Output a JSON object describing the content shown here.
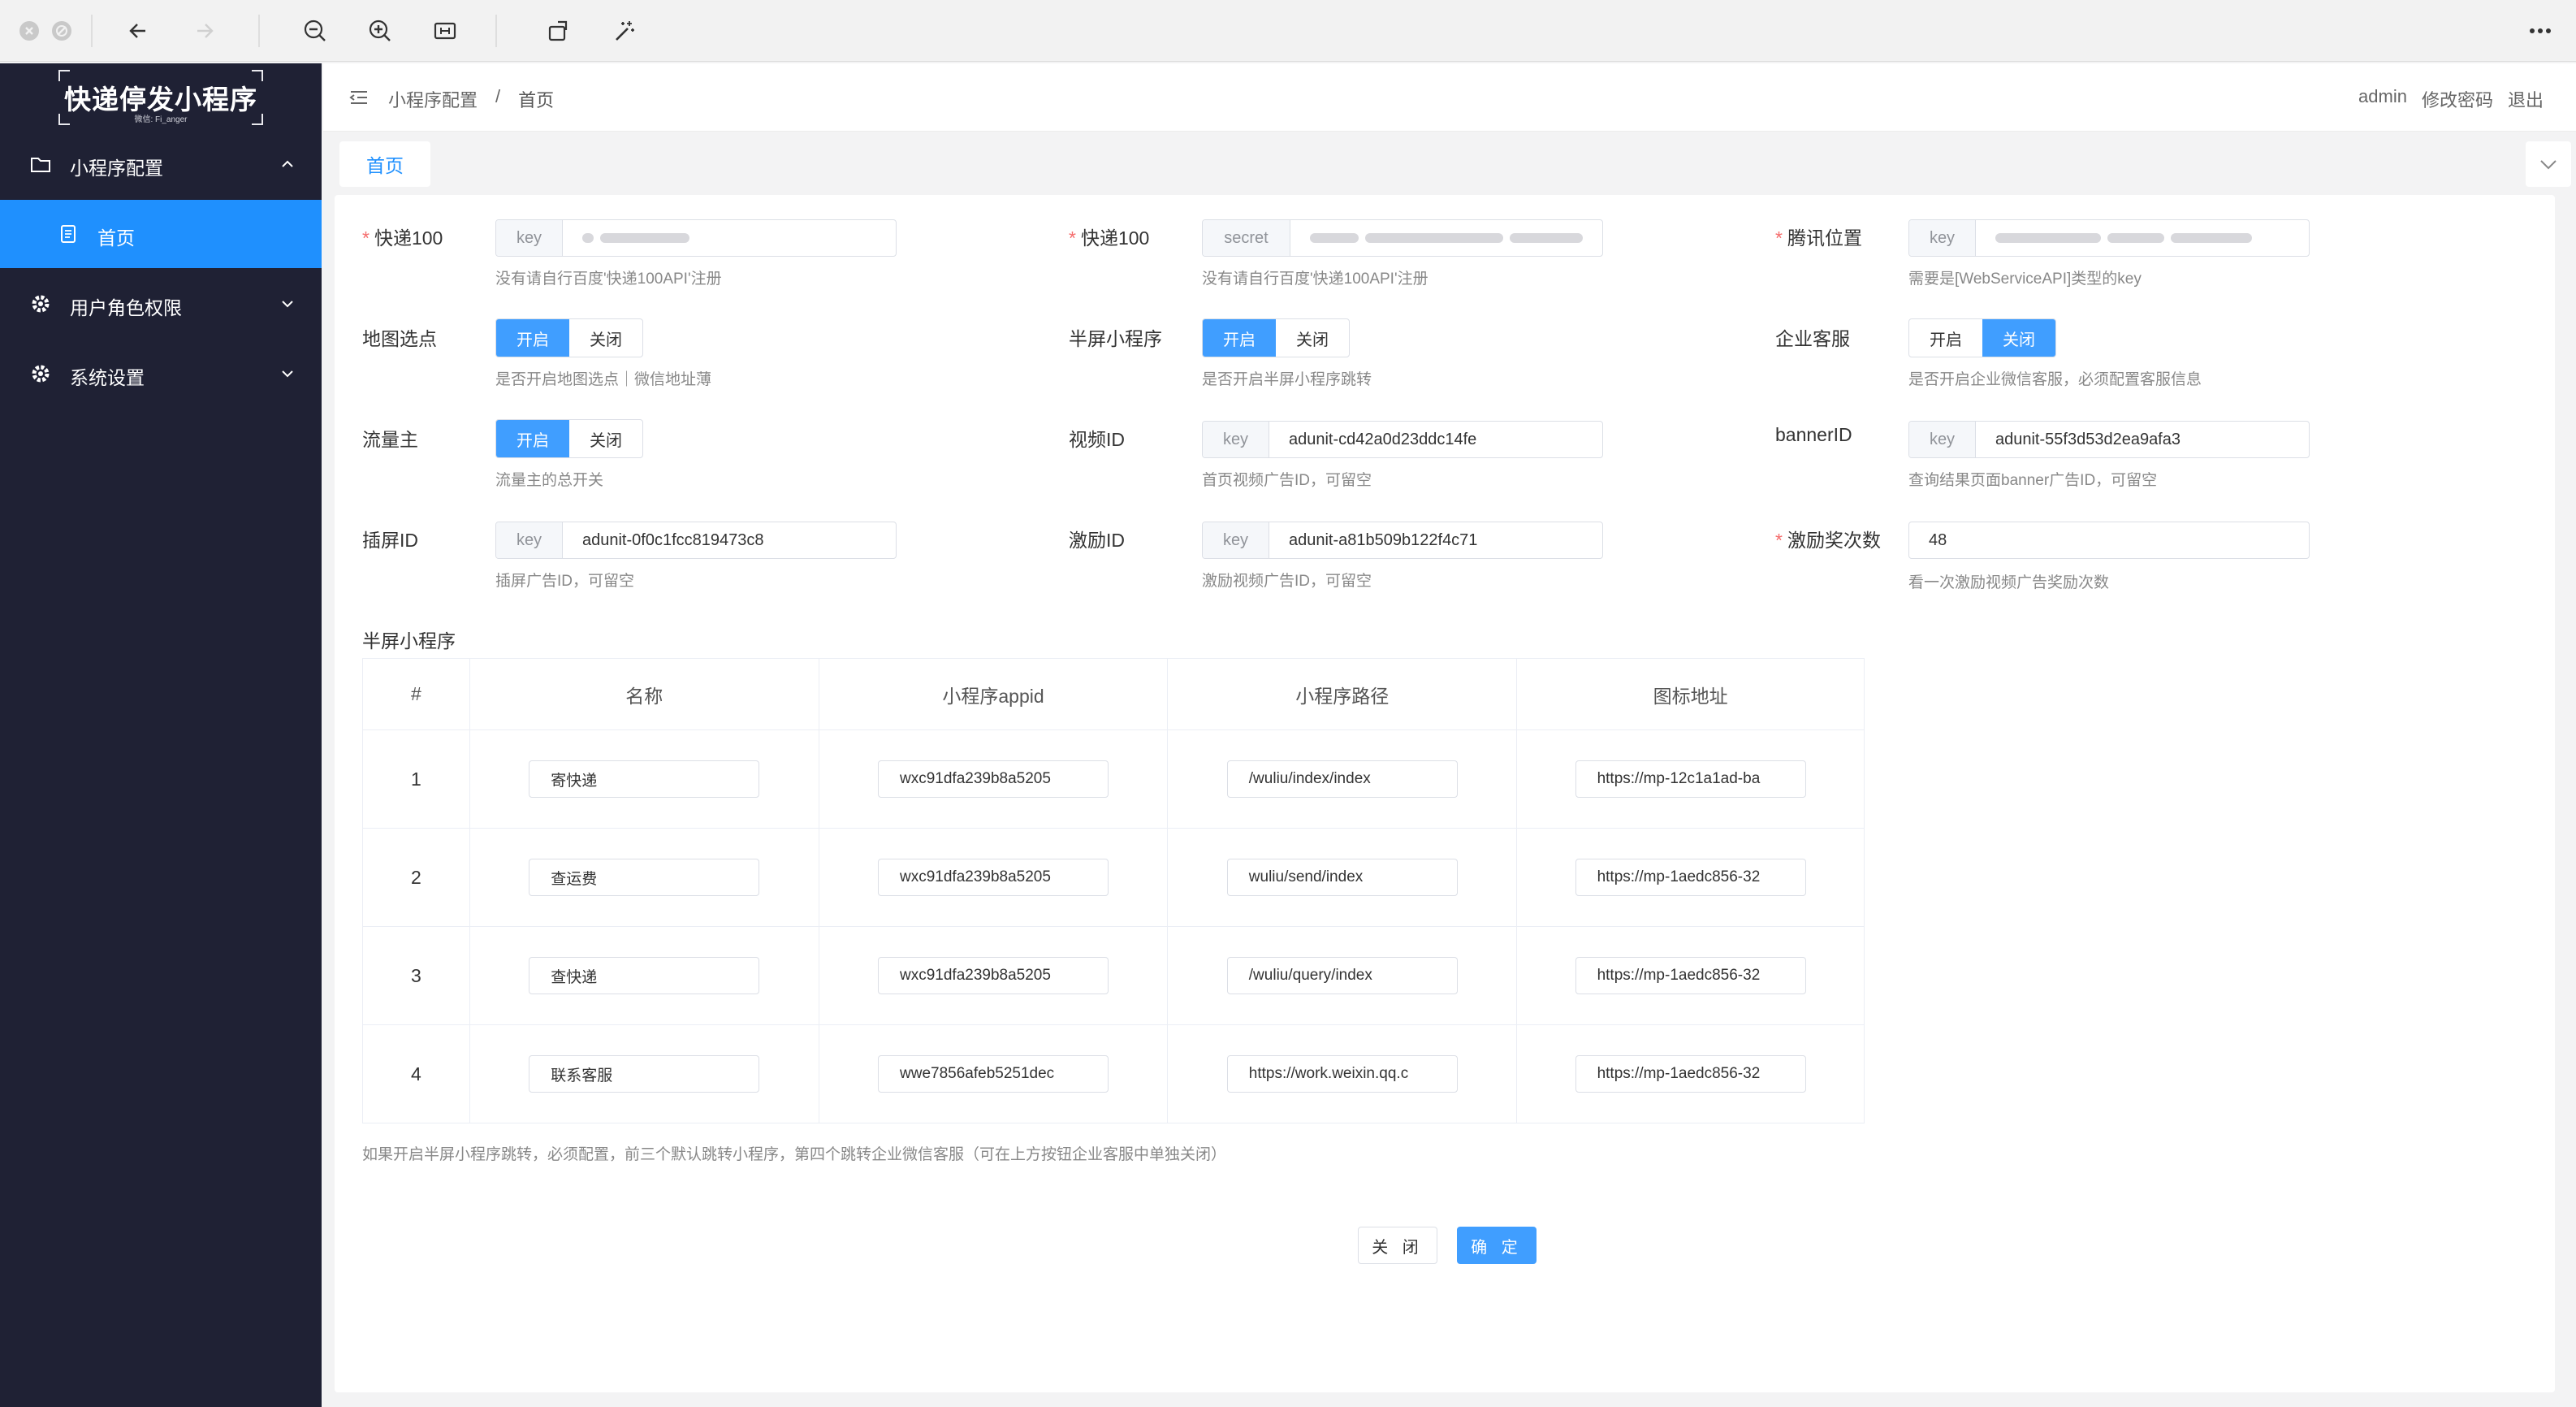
{
  "sidebar": {
    "logo_title": "快递停发小程序",
    "logo_sub": "微信: Fi_anger",
    "items": [
      {
        "label": "小程序配置",
        "icon": "folder-icon"
      },
      {
        "label": "首页",
        "icon": "document-icon"
      },
      {
        "label": "用户角色权限",
        "icon": "gear-icon"
      },
      {
        "label": "系统设置",
        "icon": "gear-icon"
      }
    ]
  },
  "header": {
    "breadcrumb": [
      "小程序配置",
      "/",
      "首页"
    ],
    "user": "admin",
    "change_password": "修改密码",
    "logout": "退出"
  },
  "tabs": {
    "active": "首页"
  },
  "form": {
    "kuaidi_key": {
      "label": "快递100",
      "prefix": "key",
      "hint": "没有请自行百度'快递100API'注册"
    },
    "kuaidi_secret": {
      "label": "快递100",
      "prefix": "secret",
      "hint": "没有请自行百度'快递100API'注册"
    },
    "tencent_loc": {
      "label": "腾讯位置",
      "prefix": "key",
      "hint": "需要是[WebServiceAPI]类型的key"
    },
    "map_select": {
      "label": "地图选点",
      "on": "开启",
      "off": "关闭",
      "hint": "是否开启地图选点｜微信地址薄"
    },
    "half_screen": {
      "label": "半屏小程序",
      "on": "开启",
      "off": "关闭",
      "hint": "是否开启半屏小程序跳转"
    },
    "enterprise_cs": {
      "label": "企业客服",
      "on": "开启",
      "off": "关闭",
      "hint": "是否开启企业微信客服，必须配置客服信息"
    },
    "traffic": {
      "label": "流量主",
      "on": "开启",
      "off": "关闭",
      "hint": "流量主的总开关"
    },
    "video_id": {
      "label": "视频ID",
      "prefix": "key",
      "value": "adunit-cd42a0d23ddc14fe",
      "hint": "首页视频广告ID，可留空"
    },
    "banner_id": {
      "label": "bannerID",
      "prefix": "key",
      "value": "adunit-55f3d53d2ea9afa3",
      "hint": "查询结果页面banner广告ID，可留空"
    },
    "interstitial_id": {
      "label": "插屏ID",
      "prefix": "key",
      "value": "adunit-0f0c1fcc819473c8",
      "hint": "插屏广告ID，可留空"
    },
    "reward_id": {
      "label": "激励ID",
      "prefix": "key",
      "value": "adunit-a81b509b122f4c71",
      "hint": "激励视频广告ID，可留空"
    },
    "reward_count": {
      "label": "激励奖次数",
      "value": "48",
      "hint": "看一次激励视频广告奖励次数"
    }
  },
  "table": {
    "title": "半屏小程序",
    "headers": [
      "#",
      "名称",
      "小程序appid",
      "小程序路径",
      "图标地址"
    ],
    "rows": [
      {
        "n": "1",
        "name": "寄快递",
        "appid": "wxc91dfa239b8a5205",
        "path": "/wuliu/index/index",
        "icon": "https://mp-12c1a1ad-ba"
      },
      {
        "n": "2",
        "name": "查运费",
        "appid": "wxc91dfa239b8a5205",
        "path": "wuliu/send/index",
        "icon": "https://mp-1aedc856-32"
      },
      {
        "n": "3",
        "name": "查快递",
        "appid": "wxc91dfa239b8a5205",
        "path": "/wuliu/query/index",
        "icon": "https://mp-1aedc856-32"
      },
      {
        "n": "4",
        "name": "联系客服",
        "appid": "wwe7856afeb5251dec",
        "path": "https://work.weixin.qq.c",
        "icon": "https://mp-1aedc856-32"
      }
    ],
    "note": "如果开启半屏小程序跳转，必须配置，前三个默认跳转小程序，第四个跳转企业微信客服（可在上方按钮企业客服中单独关闭）"
  },
  "actions": {
    "close": "关 闭",
    "confirm": "确 定"
  }
}
